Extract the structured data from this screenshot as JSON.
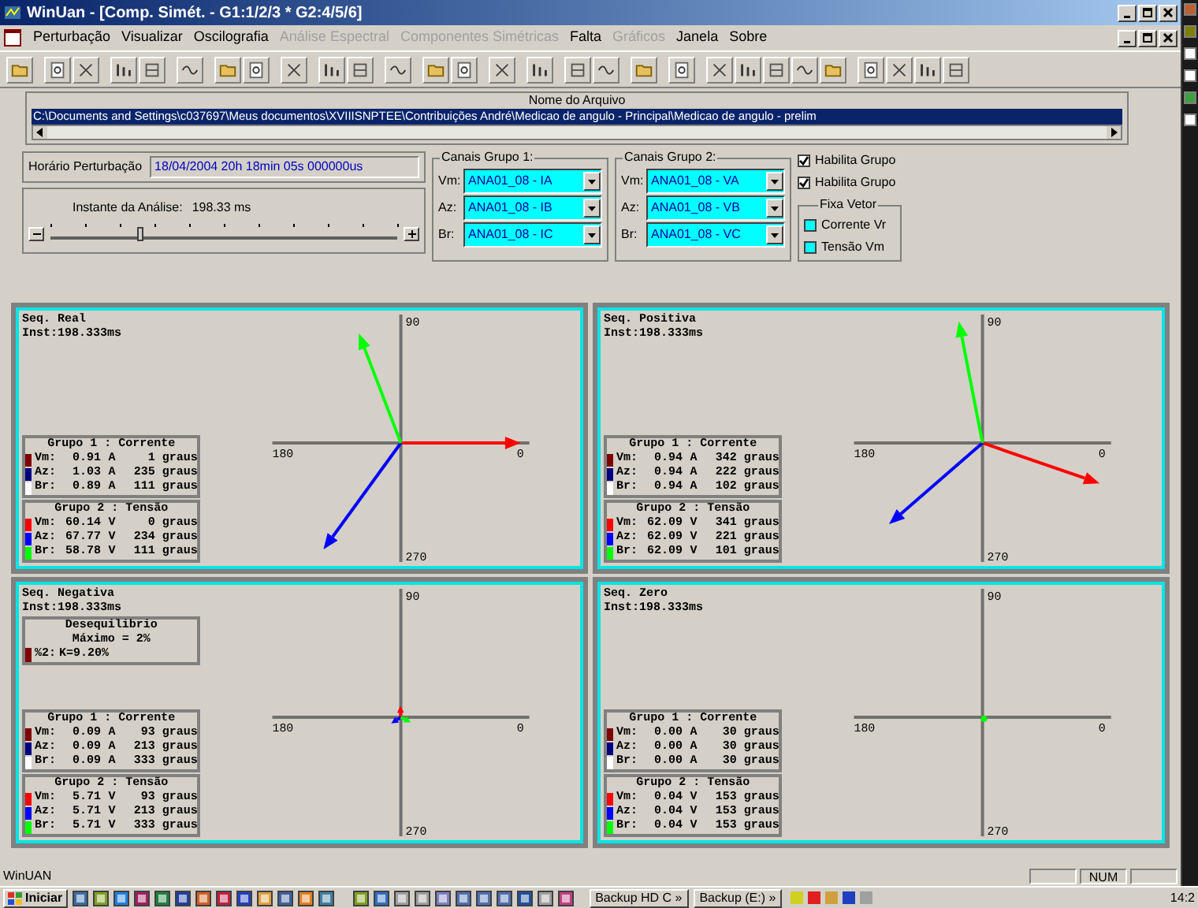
{
  "window": {
    "title": "WinUan - [Comp. Simét. - G1:1/2/3 * G2:4/5/6]"
  },
  "menu": [
    {
      "label": "Perturbação",
      "disabled": false
    },
    {
      "label": "Visualizar",
      "disabled": false
    },
    {
      "label": "Oscilografia",
      "disabled": false
    },
    {
      "label": "Análise Espectral",
      "disabled": true
    },
    {
      "label": "Componentes Simétricas",
      "disabled": true
    },
    {
      "label": "Falta",
      "disabled": false
    },
    {
      "label": "Gráficos",
      "disabled": true
    },
    {
      "label": "Janela",
      "disabled": false
    },
    {
      "label": "Sobre",
      "disabled": false
    }
  ],
  "file": {
    "label": "Nome do Arquivo",
    "path": "C:\\Documents and Settings\\c037697\\Meus documentos\\XVIIISNPTEE\\Contribuições André\\Medicao de angulo - Principal\\Medicao de angulo - prelim"
  },
  "disturbance": {
    "label": "Horário Perturbação",
    "value": "18/04/2004 20h 18min 05s 000000us"
  },
  "analysis": {
    "label": "Instante da Análise:",
    "reading": "198.33 ms",
    "level": 0.26
  },
  "channel_groups": [
    {
      "title": "Canais Grupo 1:",
      "channels": [
        {
          "label": "Vm:",
          "value": "ANA01_08 - IA"
        },
        {
          "label": "Az:",
          "value": "ANA01_08 - IB"
        },
        {
          "label": "Br:",
          "value": "ANA01_08 - IC"
        }
      ]
    },
    {
      "title": "Canais Grupo 2:",
      "channels": [
        {
          "label": "Vm:",
          "value": "ANA01_08 - VA"
        },
        {
          "label": "Az:",
          "value": "ANA01_08 - VB"
        },
        {
          "label": "Br:",
          "value": "ANA01_08 - VC"
        }
      ]
    }
  ],
  "enable_group": [
    {
      "label": "Habilita Grupo",
      "checked": true
    },
    {
      "label": "Habilita Grupo",
      "checked": true
    }
  ],
  "fix_vector": {
    "title": "Fixa Vetor",
    "options": [
      {
        "label": "Corrente Vr",
        "checked": false
      },
      {
        "label": "Tensão Vm",
        "checked": false
      }
    ]
  },
  "panels": [
    {
      "title": "Seq. Real",
      "instant": "Inst:198.333ms",
      "axis_labels": [
        "90",
        "180",
        "0",
        "270"
      ],
      "groups": [
        {
          "title": "Grupo 1 : Corrente",
          "rows": [
            {
              "label": "Vm:",
              "magnitude": "0.91",
              "unit": "A",
              "angle": "1 graus",
              "color": "#800000"
            },
            {
              "label": "Az:",
              "magnitude": "1.03",
              "unit": "A",
              "angle": "235 graus",
              "color": "#000080"
            },
            {
              "label": "Br:",
              "magnitude": "0.89",
              "unit": "A",
              "angle": "111 graus",
              "color": "#ffffff"
            }
          ]
        },
        {
          "title": "Grupo 2 : Tensão",
          "rows": [
            {
              "label": "Vm:",
              "magnitude": "60.14",
              "unit": "V",
              "angle": "0 graus",
              "color": "#ff0000"
            },
            {
              "label": "Az:",
              "magnitude": "67.77",
              "unit": "V",
              "angle": "234 graus",
              "color": "#0000ff"
            },
            {
              "label": "Br:",
              "magnitude": "58.78",
              "unit": "V",
              "angle": "111 graus",
              "color": "#00ff00"
            }
          ]
        }
      ]
    },
    {
      "title": "Seq. Positiva",
      "instant": "Inst:198.333ms",
      "axis_labels": [
        "90",
        "180",
        "0",
        "270"
      ],
      "groups": [
        {
          "title": "Grupo 1 : Corrente",
          "rows": [
            {
              "label": "Vm:",
              "magnitude": "0.94",
              "unit": "A",
              "angle": "342 graus",
              "color": "#800000"
            },
            {
              "label": "Az:",
              "magnitude": "0.94",
              "unit": "A",
              "angle": "222 graus",
              "color": "#000080"
            },
            {
              "label": "Br:",
              "magnitude": "0.94",
              "unit": "A",
              "angle": "102 graus",
              "color": "#ffffff"
            }
          ]
        },
        {
          "title": "Grupo 2 : Tensão",
          "rows": [
            {
              "label": "Vm:",
              "magnitude": "62.09",
              "unit": "V",
              "angle": "341 graus",
              "color": "#ff0000"
            },
            {
              "label": "Az:",
              "magnitude": "62.09",
              "unit": "V",
              "angle": "221 graus",
              "color": "#0000ff"
            },
            {
              "label": "Br:",
              "magnitude": "62.09",
              "unit": "V",
              "angle": "101 graus",
              "color": "#00ff00"
            }
          ]
        }
      ]
    },
    {
      "title": "Seq. Negativa",
      "instant": "Inst:198.333ms",
      "axis_labels": [
        "90",
        "180",
        "0",
        "270"
      ],
      "unbalance": {
        "title": "Desequilibrio",
        "limit": "Máximo = 2%",
        "row": {
          "label": "%2:",
          "value": "K=9.20%",
          "color": "#800000"
        }
      },
      "groups": [
        {
          "title": "Grupo 1 : Corrente",
          "rows": [
            {
              "label": "Vm:",
              "magnitude": "0.09",
              "unit": "A",
              "angle": "93 graus",
              "color": "#800000"
            },
            {
              "label": "Az:",
              "magnitude": "0.09",
              "unit": "A",
              "angle": "213 graus",
              "color": "#000080"
            },
            {
              "label": "Br:",
              "magnitude": "0.09",
              "unit": "A",
              "angle": "333 graus",
              "color": "#ffffff"
            }
          ]
        },
        {
          "title": "Grupo 2 : Tensão",
          "rows": [
            {
              "label": "Vm:",
              "magnitude": "5.71",
              "unit": "V",
              "angle": "93 graus",
              "color": "#ff0000"
            },
            {
              "label": "Az:",
              "magnitude": "5.71",
              "unit": "V",
              "angle": "213 graus",
              "color": "#0000ff"
            },
            {
              "label": "Br:",
              "magnitude": "5.71",
              "unit": "V",
              "angle": "333 graus",
              "color": "#00ff00"
            }
          ]
        }
      ]
    },
    {
      "title": "Seq. Zero",
      "instant": "Inst:198.333ms",
      "axis_labels": [
        "90",
        "180",
        "0",
        "270"
      ],
      "groups": [
        {
          "title": "Grupo 1 : Corrente",
          "rows": [
            {
              "label": "Vm:",
              "magnitude": "0.00",
              "unit": "A",
              "angle": "30 graus",
              "color": "#800000"
            },
            {
              "label": "Az:",
              "magnitude": "0.00",
              "unit": "A",
              "angle": "30 graus",
              "color": "#000080"
            },
            {
              "label": "Br:",
              "magnitude": "0.00",
              "unit": "A",
              "angle": "30 graus",
              "color": "#ffffff"
            }
          ]
        },
        {
          "title": "Grupo 2 : Tensão",
          "rows": [
            {
              "label": "Vm:",
              "magnitude": "0.04",
              "unit": "V",
              "angle": "153 graus",
              "color": "#ff0000"
            },
            {
              "label": "Az:",
              "magnitude": "0.04",
              "unit": "V",
              "angle": "153 graus",
              "color": "#0000ff"
            },
            {
              "label": "Br:",
              "magnitude": "0.04",
              "unit": "V",
              "angle": "153 graus",
              "color": "#00ff00"
            }
          ]
        }
      ]
    }
  ],
  "status_bar": {
    "text": "WinUAN",
    "indicators": [
      "NUM"
    ]
  },
  "taskbar": {
    "start": "Iniciar",
    "tasks": [
      "Backup HD C »",
      "Backup (E:) »"
    ],
    "clock": "14:2"
  }
}
